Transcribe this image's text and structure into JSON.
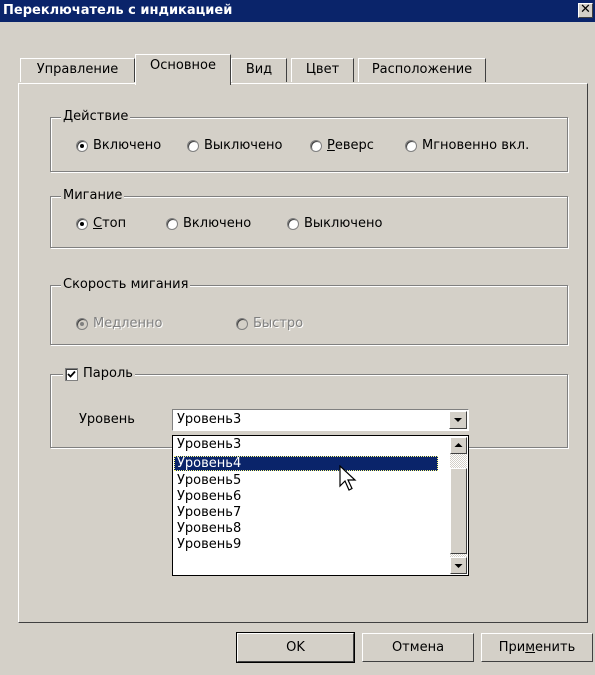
{
  "window": {
    "title": "Переключатель с индикацией",
    "close_glyph": "✕"
  },
  "tabs": [
    {
      "label": "Управление"
    },
    {
      "label": "Основное",
      "active": true
    },
    {
      "label": "Вид"
    },
    {
      "label": "Цвет"
    },
    {
      "label": "Расположение"
    }
  ],
  "action_group": {
    "legend": "Действие",
    "options": [
      {
        "label": "Включено",
        "selected": true
      },
      {
        "label": "Выключено",
        "selected": false
      },
      {
        "label_prefix": "",
        "label_underlined": "Р",
        "label_rest": "еверс",
        "selected": false
      },
      {
        "label": "Мгновенно вкл.",
        "selected": false
      }
    ]
  },
  "blink_group": {
    "legend": "Мигание",
    "options": [
      {
        "label_underlined": "С",
        "label_rest": "топ",
        "selected": true
      },
      {
        "label": "Включено",
        "selected": false
      },
      {
        "label": "Выключено",
        "selected": false
      }
    ]
  },
  "speed_group": {
    "legend": "Скорость мигания",
    "disabled": true,
    "options": [
      {
        "label": "Медленно",
        "selected": true
      },
      {
        "label": "Быстро",
        "selected": false
      }
    ]
  },
  "password_group": {
    "checkbox_label": "Пароль",
    "checked": true,
    "level_label": "Уровень",
    "level_value": "Уровень3",
    "dropdown_items": [
      "Уровень3",
      "Уровень4",
      "Уровень5",
      "Уровень6",
      "Уровень7",
      "Уровень8",
      "Уровень9"
    ],
    "highlighted_item": "Уровень4"
  },
  "buttons": {
    "ok": "OK",
    "cancel": "Отмена",
    "apply_prefix": "При",
    "apply_underlined": "м",
    "apply_rest": "енить"
  },
  "colors": {
    "title_bar": "#0a246a",
    "face": "#d4d0c8",
    "highlight": "#0a246a"
  }
}
